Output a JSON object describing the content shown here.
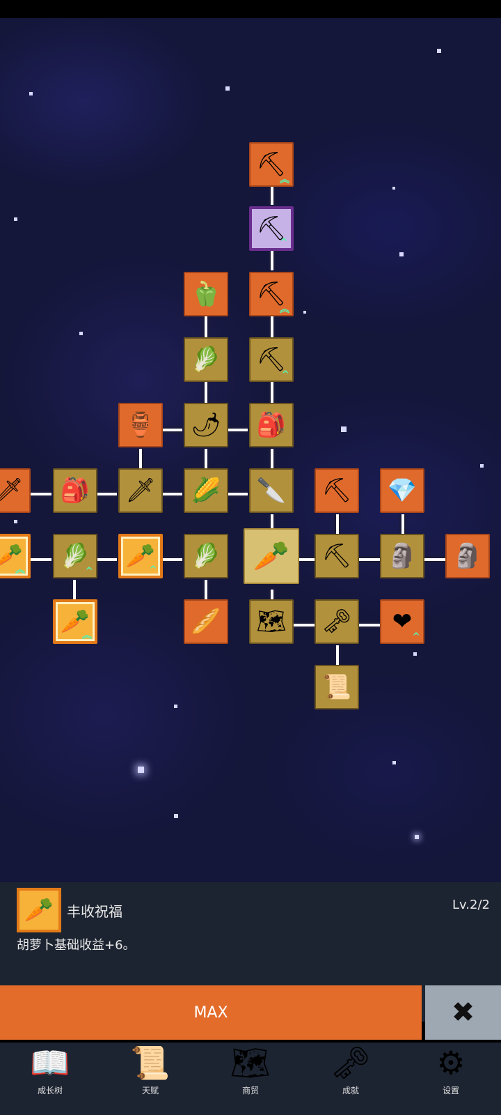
{
  "skill_panel": {
    "title": "丰收祝福",
    "level": "Lv.2/2",
    "description": "胡萝卜基础收益+6。",
    "icon": "golden-carrot-icon"
  },
  "actions": {
    "max_label": "MAX",
    "close_icon": "close-x-icon"
  },
  "bottom_nav": [
    {
      "label": "成长树",
      "icon": "book-icon"
    },
    {
      "label": "天赋",
      "icon": "scroll-icon"
    },
    {
      "label": "商贸",
      "icon": "map-icon"
    },
    {
      "label": "成就",
      "icon": "key-icon"
    },
    {
      "label": "设置",
      "icon": "gear-icon"
    }
  ],
  "colors": {
    "locked_node": "#e06a2c",
    "owned_node": "#b2913d",
    "max_button": "#e36c2a",
    "panel_bg": "#1d2431"
  }
}
